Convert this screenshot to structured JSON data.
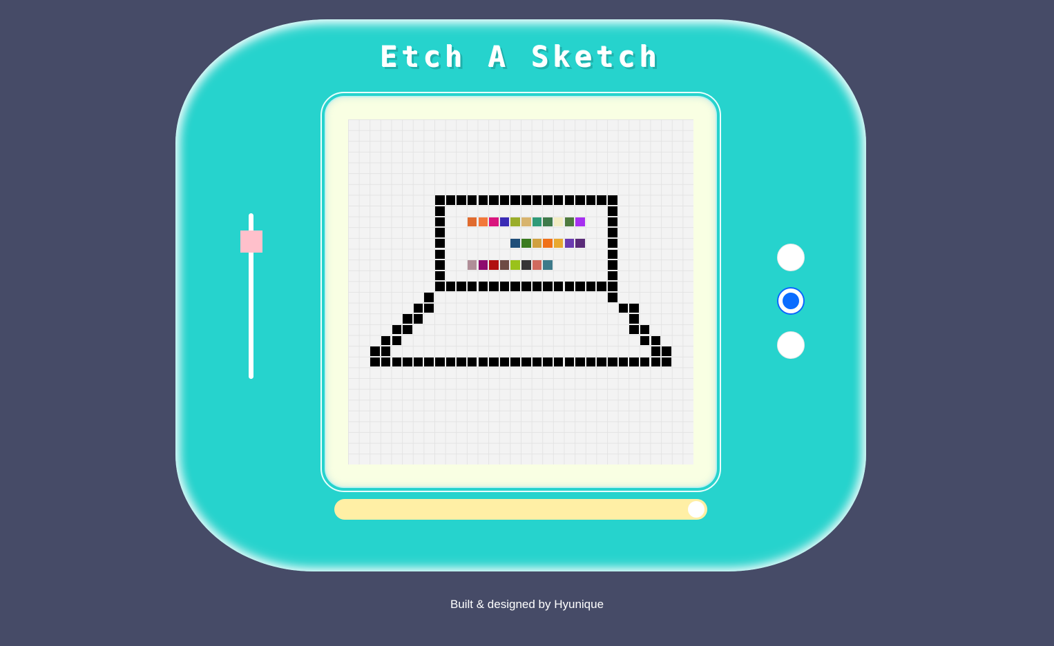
{
  "app": {
    "title": "Etch A Sketch"
  },
  "footer": {
    "text": "Built & designed by Hyunique"
  },
  "colors": {
    "background": "#464b67",
    "device": "#26d3cd",
    "screen": "#f9ffe3",
    "grid_background": "#f3f3f3",
    "grid_line": "#e3e3e3",
    "pixel_black": "#000000",
    "size_slider_thumb": "#ffc0cb",
    "opacity_slider_track": "#ffefa5",
    "radio_accent": "#0a6cff"
  },
  "controls": {
    "size_slider": {
      "orientation": "vertical",
      "value_fraction": 0.12
    },
    "mode_radios": [
      {
        "checked": false
      },
      {
        "checked": true
      },
      {
        "checked": false
      }
    ],
    "bottom_slider": {
      "orientation": "horizontal",
      "value_fraction": 0.97
    }
  },
  "grid": {
    "size": 32,
    "cells": [
      {
        "r": 7,
        "c": 8,
        "color": "#000000"
      },
      {
        "r": 7,
        "c": 9,
        "color": "#000000"
      },
      {
        "r": 7,
        "c": 10,
        "color": "#000000"
      },
      {
        "r": 7,
        "c": 11,
        "color": "#000000"
      },
      {
        "r": 7,
        "c": 12,
        "color": "#000000"
      },
      {
        "r": 7,
        "c": 13,
        "color": "#000000"
      },
      {
        "r": 7,
        "c": 14,
        "color": "#000000"
      },
      {
        "r": 7,
        "c": 15,
        "color": "#000000"
      },
      {
        "r": 7,
        "c": 16,
        "color": "#000000"
      },
      {
        "r": 7,
        "c": 17,
        "color": "#000000"
      },
      {
        "r": 7,
        "c": 18,
        "color": "#000000"
      },
      {
        "r": 7,
        "c": 19,
        "color": "#000000"
      },
      {
        "r": 7,
        "c": 20,
        "color": "#000000"
      },
      {
        "r": 7,
        "c": 21,
        "color": "#000000"
      },
      {
        "r": 7,
        "c": 22,
        "color": "#000000"
      },
      {
        "r": 7,
        "c": 23,
        "color": "#000000"
      },
      {
        "r": 7,
        "c": 24,
        "color": "#000000"
      },
      {
        "r": 8,
        "c": 8,
        "color": "#000000"
      },
      {
        "r": 8,
        "c": 24,
        "color": "#000000"
      },
      {
        "r": 9,
        "c": 8,
        "color": "#000000"
      },
      {
        "r": 9,
        "c": 24,
        "color": "#000000"
      },
      {
        "r": 10,
        "c": 8,
        "color": "#000000"
      },
      {
        "r": 10,
        "c": 24,
        "color": "#000000"
      },
      {
        "r": 11,
        "c": 8,
        "color": "#000000"
      },
      {
        "r": 11,
        "c": 24,
        "color": "#000000"
      },
      {
        "r": 12,
        "c": 8,
        "color": "#000000"
      },
      {
        "r": 12,
        "c": 24,
        "color": "#000000"
      },
      {
        "r": 13,
        "c": 8,
        "color": "#000000"
      },
      {
        "r": 13,
        "c": 24,
        "color": "#000000"
      },
      {
        "r": 14,
        "c": 8,
        "color": "#000000"
      },
      {
        "r": 14,
        "c": 24,
        "color": "#000000"
      },
      {
        "r": 15,
        "c": 8,
        "color": "#000000"
      },
      {
        "r": 15,
        "c": 9,
        "color": "#000000"
      },
      {
        "r": 15,
        "c": 10,
        "color": "#000000"
      },
      {
        "r": 15,
        "c": 11,
        "color": "#000000"
      },
      {
        "r": 15,
        "c": 12,
        "color": "#000000"
      },
      {
        "r": 15,
        "c": 13,
        "color": "#000000"
      },
      {
        "r": 15,
        "c": 14,
        "color": "#000000"
      },
      {
        "r": 15,
        "c": 15,
        "color": "#000000"
      },
      {
        "r": 15,
        "c": 16,
        "color": "#000000"
      },
      {
        "r": 15,
        "c": 17,
        "color": "#000000"
      },
      {
        "r": 15,
        "c": 18,
        "color": "#000000"
      },
      {
        "r": 15,
        "c": 19,
        "color": "#000000"
      },
      {
        "r": 15,
        "c": 20,
        "color": "#000000"
      },
      {
        "r": 15,
        "c": 21,
        "color": "#000000"
      },
      {
        "r": 15,
        "c": 22,
        "color": "#000000"
      },
      {
        "r": 15,
        "c": 23,
        "color": "#000000"
      },
      {
        "r": 15,
        "c": 24,
        "color": "#000000"
      },
      {
        "r": 16,
        "c": 7,
        "color": "#000000"
      },
      {
        "r": 16,
        "c": 24,
        "color": "#000000"
      },
      {
        "r": 17,
        "c": 6,
        "color": "#000000"
      },
      {
        "r": 17,
        "c": 7,
        "color": "#000000"
      },
      {
        "r": 17,
        "c": 25,
        "color": "#000000"
      },
      {
        "r": 17,
        "c": 26,
        "color": "#000000"
      },
      {
        "r": 18,
        "c": 5,
        "color": "#000000"
      },
      {
        "r": 18,
        "c": 6,
        "color": "#000000"
      },
      {
        "r": 18,
        "c": 26,
        "color": "#000000"
      },
      {
        "r": 19,
        "c": 4,
        "color": "#000000"
      },
      {
        "r": 19,
        "c": 5,
        "color": "#000000"
      },
      {
        "r": 19,
        "c": 26,
        "color": "#000000"
      },
      {
        "r": 19,
        "c": 27,
        "color": "#000000"
      },
      {
        "r": 20,
        "c": 3,
        "color": "#000000"
      },
      {
        "r": 20,
        "c": 4,
        "color": "#000000"
      },
      {
        "r": 20,
        "c": 27,
        "color": "#000000"
      },
      {
        "r": 20,
        "c": 28,
        "color": "#000000"
      },
      {
        "r": 21,
        "c": 2,
        "color": "#000000"
      },
      {
        "r": 21,
        "c": 3,
        "color": "#000000"
      },
      {
        "r": 21,
        "c": 28,
        "color": "#000000"
      },
      {
        "r": 21,
        "c": 29,
        "color": "#000000"
      },
      {
        "r": 22,
        "c": 2,
        "color": "#000000"
      },
      {
        "r": 22,
        "c": 3,
        "color": "#000000"
      },
      {
        "r": 22,
        "c": 4,
        "color": "#000000"
      },
      {
        "r": 22,
        "c": 5,
        "color": "#000000"
      },
      {
        "r": 22,
        "c": 6,
        "color": "#000000"
      },
      {
        "r": 22,
        "c": 7,
        "color": "#000000"
      },
      {
        "r": 22,
        "c": 8,
        "color": "#000000"
      },
      {
        "r": 22,
        "c": 9,
        "color": "#000000"
      },
      {
        "r": 22,
        "c": 10,
        "color": "#000000"
      },
      {
        "r": 22,
        "c": 11,
        "color": "#000000"
      },
      {
        "r": 22,
        "c": 12,
        "color": "#000000"
      },
      {
        "r": 22,
        "c": 13,
        "color": "#000000"
      },
      {
        "r": 22,
        "c": 14,
        "color": "#000000"
      },
      {
        "r": 22,
        "c": 15,
        "color": "#000000"
      },
      {
        "r": 22,
        "c": 16,
        "color": "#000000"
      },
      {
        "r": 22,
        "c": 17,
        "color": "#000000"
      },
      {
        "r": 22,
        "c": 18,
        "color": "#000000"
      },
      {
        "r": 22,
        "c": 19,
        "color": "#000000"
      },
      {
        "r": 22,
        "c": 20,
        "color": "#000000"
      },
      {
        "r": 22,
        "c": 21,
        "color": "#000000"
      },
      {
        "r": 22,
        "c": 22,
        "color": "#000000"
      },
      {
        "r": 22,
        "c": 23,
        "color": "#000000"
      },
      {
        "r": 22,
        "c": 24,
        "color": "#000000"
      },
      {
        "r": 22,
        "c": 25,
        "color": "#000000"
      },
      {
        "r": 22,
        "c": 26,
        "color": "#000000"
      },
      {
        "r": 22,
        "c": 27,
        "color": "#000000"
      },
      {
        "r": 22,
        "c": 28,
        "color": "#000000"
      },
      {
        "r": 22,
        "c": 29,
        "color": "#000000"
      },
      {
        "r": 9,
        "c": 11,
        "color": "#e06b2e"
      },
      {
        "r": 9,
        "c": 12,
        "color": "#f2783a"
      },
      {
        "r": 9,
        "c": 13,
        "color": "#d9157d"
      },
      {
        "r": 9,
        "c": 14,
        "color": "#3a2bb5"
      },
      {
        "r": 9,
        "c": 15,
        "color": "#9aad2a"
      },
      {
        "r": 9,
        "c": 16,
        "color": "#d8b46e"
      },
      {
        "r": 9,
        "c": 17,
        "color": "#2f9a78"
      },
      {
        "r": 9,
        "c": 18,
        "color": "#3f7a4a"
      },
      {
        "r": 9,
        "c": 19,
        "color": "#f2ecc3"
      },
      {
        "r": 9,
        "c": 20,
        "color": "#4e7a3e"
      },
      {
        "r": 9,
        "c": 21,
        "color": "#a630f0"
      },
      {
        "r": 11,
        "c": 15,
        "color": "#1f4e79"
      },
      {
        "r": 11,
        "c": 16,
        "color": "#3a7a1e"
      },
      {
        "r": 11,
        "c": 17,
        "color": "#d0a040"
      },
      {
        "r": 11,
        "c": 18,
        "color": "#f07018"
      },
      {
        "r": 11,
        "c": 19,
        "color": "#e8a830"
      },
      {
        "r": 11,
        "c": 20,
        "color": "#6a3ab0"
      },
      {
        "r": 11,
        "c": 21,
        "color": "#5a2a78"
      },
      {
        "r": 13,
        "c": 11,
        "color": "#b08e98"
      },
      {
        "r": 13,
        "c": 12,
        "color": "#8e0b6e"
      },
      {
        "r": 13,
        "c": 13,
        "color": "#b01010"
      },
      {
        "r": 13,
        "c": 14,
        "color": "#6e4a45"
      },
      {
        "r": 13,
        "c": 15,
        "color": "#9ac21a"
      },
      {
        "r": 13,
        "c": 16,
        "color": "#353535"
      },
      {
        "r": 13,
        "c": 17,
        "color": "#d06a5e"
      },
      {
        "r": 13,
        "c": 18,
        "color": "#3e7a8a"
      }
    ]
  }
}
